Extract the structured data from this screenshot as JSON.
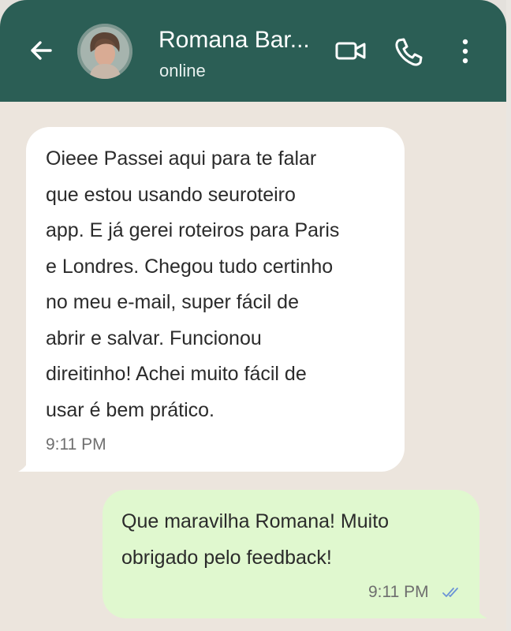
{
  "header": {
    "contact_name": "Romana Bar...",
    "status": "online",
    "color": "#2b5e55"
  },
  "icons": {
    "back": "arrow-left",
    "video": "video-camera",
    "call": "phone",
    "menu": "three-dots-vertical",
    "read": "double-check"
  },
  "messages": [
    {
      "direction": "incoming",
      "lines": [
        "Oieee Passei aqui para te falar",
        "que estou usando seuroteiro",
        "app. E já gerei roteiros para Paris",
        "e Londres. Chegou tudo certinho",
        "no meu e-mail, super fácil de",
        "abrir e salvar. Funcionou",
        "direitinho! Achei muito fácil de",
        "usar é bem prático."
      ],
      "time": "9:11 PM",
      "bubble_color": "#ffffff"
    },
    {
      "direction": "outgoing",
      "lines": [
        "Que maravilha Romana! Muito",
        "obrigado pelo feedback!"
      ],
      "time": "9:11 PM",
      "bubble_color": "#e0f8cf",
      "read_color": "#6b93d6"
    }
  ]
}
